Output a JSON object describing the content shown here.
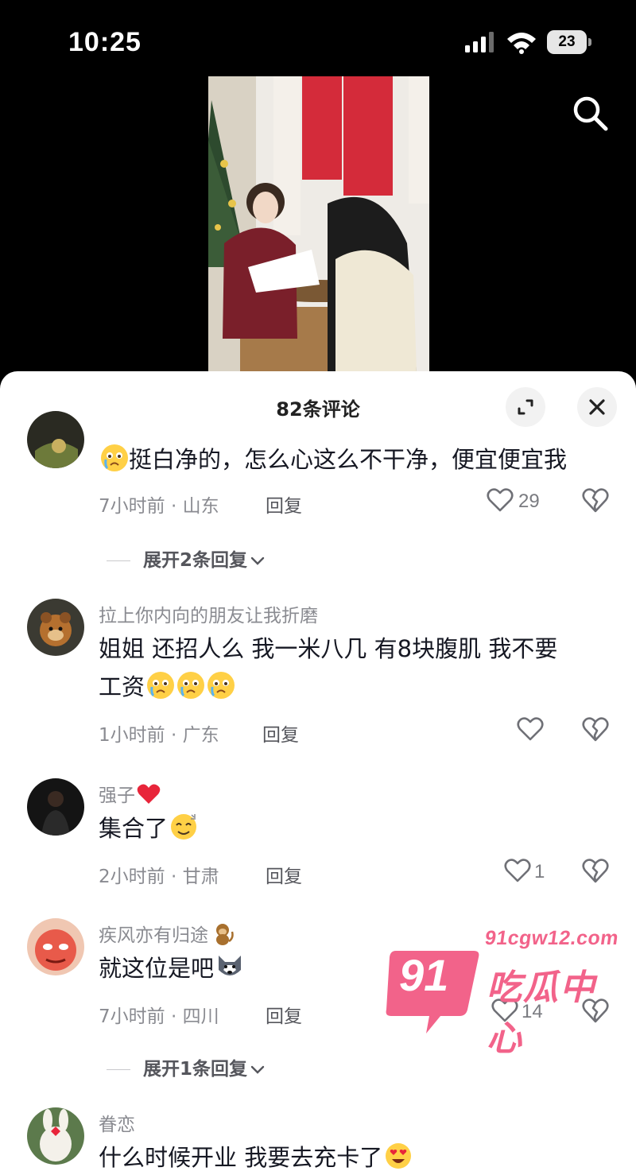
{
  "status_bar": {
    "time": "10:25",
    "battery": "23"
  },
  "sheet": {
    "title": "82条评论"
  },
  "comments": [
    {
      "username": "",
      "text": "挺白净的，怎么心这么不干净，便宜便宜我",
      "time_location": "7小时前 · 山东",
      "reply_label": "回复",
      "likes": "29"
    },
    {
      "username": "拉上你内向的朋友让我折磨",
      "text_line1": "姐姐 还招人么 我一米八几  有8块腹肌 我不要",
      "text_line2": "工资",
      "time_location": "1小时前 · 广东",
      "reply_label": "回复",
      "likes": ""
    },
    {
      "username": "强子",
      "text": "集合了",
      "time_location": "2小时前 · 甘肃",
      "reply_label": "回复",
      "likes": "1"
    },
    {
      "username": "疾风亦有归途",
      "text": "就这位是吧",
      "time_location": "7小时前 · 四川",
      "reply_label": "回复",
      "likes": "14"
    },
    {
      "username": "眷恋",
      "text": "什么时候开业 我要去充卡了"
    }
  ],
  "expand_replies": [
    "展开2条回复",
    "展开1条回复"
  ],
  "watermark": {
    "url": "91cgw12.com",
    "badge": "91",
    "label": "吃瓜中心"
  },
  "icons": {
    "status": [
      "signal-icon",
      "wifi-icon",
      "battery-icon"
    ],
    "header": [
      "search-icon",
      "expand-icon",
      "close-icon"
    ],
    "actions": [
      "heart-outline-icon",
      "broken-heart-icon"
    ],
    "emojis": [
      "crying-face-emoji",
      "dizzy-face-emoji",
      "monkey-emoji",
      "wolf-emoji",
      "heart-eyes-emoji",
      "red-heart-emoji"
    ]
  },
  "colors": {
    "accent_pink": "#f2638a",
    "muted_text": "#8a8b91",
    "primary_text": "#161823"
  }
}
